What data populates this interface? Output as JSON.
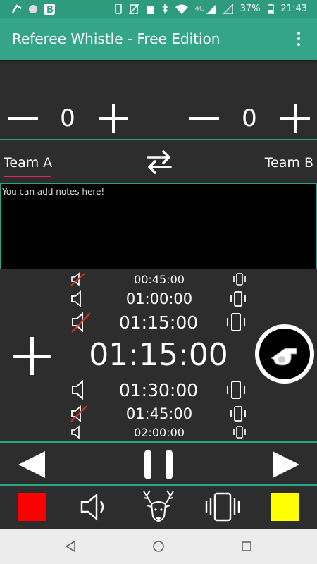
{
  "status_bar": {
    "battery": "37%",
    "time": "21:43",
    "network": "4G",
    "icons": [
      "ring-app-icon",
      "dot-icon",
      "b-app-icon",
      "phone-icon",
      "no-sim-icon",
      "clipboard-icon",
      "bluetooth-icon",
      "wifi-icon",
      "signal-icon",
      "signal-icon",
      "battery-icon"
    ]
  },
  "app_bar": {
    "title": "Referee Whistle - Free Edition",
    "menu_icon": "overflow-menu-icon"
  },
  "scores": {
    "team_a_score": "0",
    "team_b_score": "0"
  },
  "teams": {
    "team_a": "Team A",
    "team_b": "Team B",
    "swap_icon": "swap-arrows-icon"
  },
  "notes": {
    "placeholder": "You can add notes here!"
  },
  "timer": {
    "current": "01:15:00",
    "presets": [
      {
        "time": "00:45:00",
        "sound_muted": true
      },
      {
        "time": "01:00:00",
        "sound_muted": false
      },
      {
        "time": "01:15:00",
        "sound_muted": true
      },
      {
        "time": "01:30:00",
        "sound_muted": false
      },
      {
        "time": "01:45:00",
        "sound_muted": true
      },
      {
        "time": "02:00:00",
        "sound_muted": false
      }
    ]
  },
  "colors": {
    "accent": "#35a58a",
    "status_bar": "#2f9b7e",
    "divider": "#2aa38a",
    "team_underline": "#e0245e",
    "red_card": "#ff0000",
    "yellow_card": "#ffff00",
    "background": "#2d2d2d"
  }
}
